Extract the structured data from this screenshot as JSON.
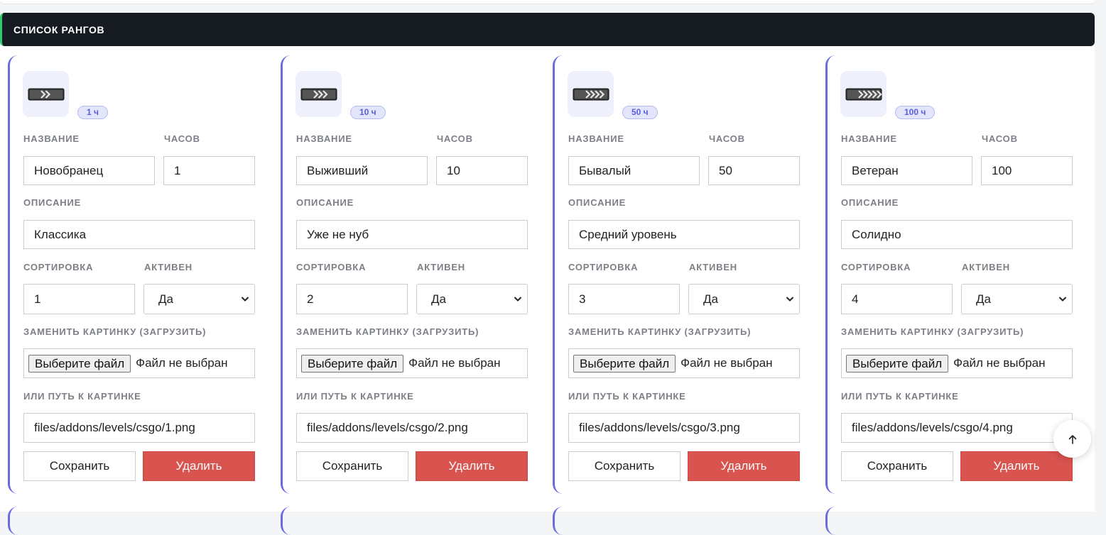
{
  "panel": {
    "title": "СПИСОК РАНГОВ"
  },
  "labels": {
    "name": "НАЗВАНИЕ",
    "hours": "ЧАСОВ",
    "description": "ОПИСАНИЕ",
    "sort": "СОРТИРОВКА",
    "active": "АКТИВЕН",
    "replace_image": "ЗАМЕНИТЬ КАРТИНКУ (ЗАГРУЗИТЬ)",
    "image_path": "ИЛИ ПУТЬ К КАРТИНКЕ"
  },
  "buttons": {
    "choose_file": "Выберите файл",
    "no_file": "Файл не выбран",
    "save": "Сохранить",
    "delete": "Удалить"
  },
  "ranks": [
    {
      "badge": "1 ч",
      "icon": "rank-1-chevrons-icon",
      "name": "Новобранец",
      "hours": "1",
      "description": "Классика",
      "sort": "1",
      "active": "Да",
      "path": "files/addons/levels/csgo/1.png"
    },
    {
      "badge": "10 ч",
      "icon": "rank-2-chevrons-icon",
      "name": "Выживший",
      "hours": "10",
      "description": "Уже не нуб",
      "sort": "2",
      "active": "Да",
      "path": "files/addons/levels/csgo/2.png"
    },
    {
      "badge": "50 ч",
      "icon": "rank-3-chevrons-icon",
      "name": "Бывалый",
      "hours": "50",
      "description": "Средний уровень",
      "sort": "3",
      "active": "Да",
      "path": "files/addons/levels/csgo/3.png"
    },
    {
      "badge": "100 ч",
      "icon": "rank-4-chevrons-icon",
      "name": "Ветеран",
      "hours": "100",
      "description": "Солидно",
      "sort": "4",
      "active": "Да",
      "path": "files/addons/levels/csgo/4.png"
    }
  ],
  "colors": {
    "header_bg": "#161a21",
    "card_accent": "#6b6be0",
    "delete_bg": "#d9534f",
    "badge_text": "#5a5fd6"
  },
  "fab": {
    "icon": "arrow-up-icon"
  }
}
